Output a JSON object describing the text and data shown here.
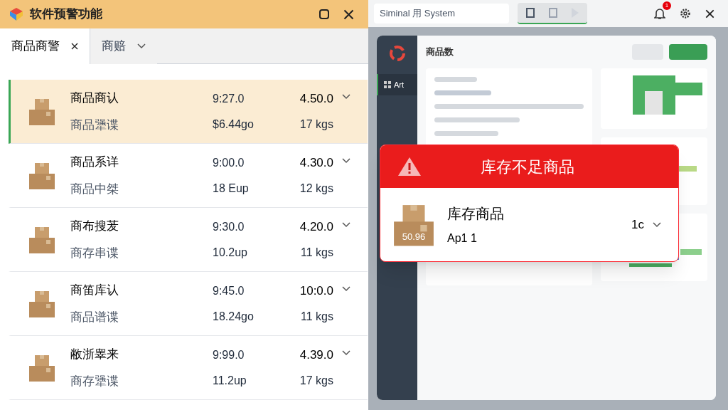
{
  "window": {
    "title": "软件预警功能"
  },
  "tabs": [
    {
      "label": "商品商警",
      "selected": true,
      "kind": "closable"
    },
    {
      "label": "商赔",
      "selected": false,
      "kind": "dropdown"
    }
  ],
  "items": [
    {
      "name": "商品商认",
      "detail": "商品犟谍",
      "time": "9:27.0",
      "amount": "$6.44go",
      "value": "4.50.0",
      "weight": "17 kgs",
      "selected": true
    },
    {
      "name": "商品系详",
      "detail": "商品中桀",
      "time": "9:00.0",
      "amount": "18 Eup",
      "value": "4.30.0",
      "weight": "12 kgs",
      "selected": false
    },
    {
      "name": "商布搜茇",
      "detail": "商存串谍",
      "time": "9:30.0",
      "amount": "10.2up",
      "value": "4.20.0",
      "weight": "11 kgs",
      "selected": false
    },
    {
      "name": "商笛库认",
      "detail": "商品谱谍",
      "time": "9:45.0",
      "amount": "18.24go",
      "value": "10:0.0",
      "weight": "11 kgs",
      "selected": false
    },
    {
      "name": "敝浙睾来",
      "detail": "商存犟谍",
      "time": "9:99.0",
      "amount": "11.2up",
      "value": "4.39.0",
      "weight": "17 kgs",
      "selected": false
    }
  ],
  "background_app": {
    "title": "Siminal 用 System",
    "notification_count": "1",
    "page_title": "商品数",
    "nav": [
      {
        "label": "Art",
        "selected": true
      }
    ]
  },
  "alert": {
    "title": "库存不足商品",
    "item": {
      "name": "库存商品",
      "code": "Ap1 1",
      "box_label": "50.96",
      "quantity": "1c"
    }
  }
}
